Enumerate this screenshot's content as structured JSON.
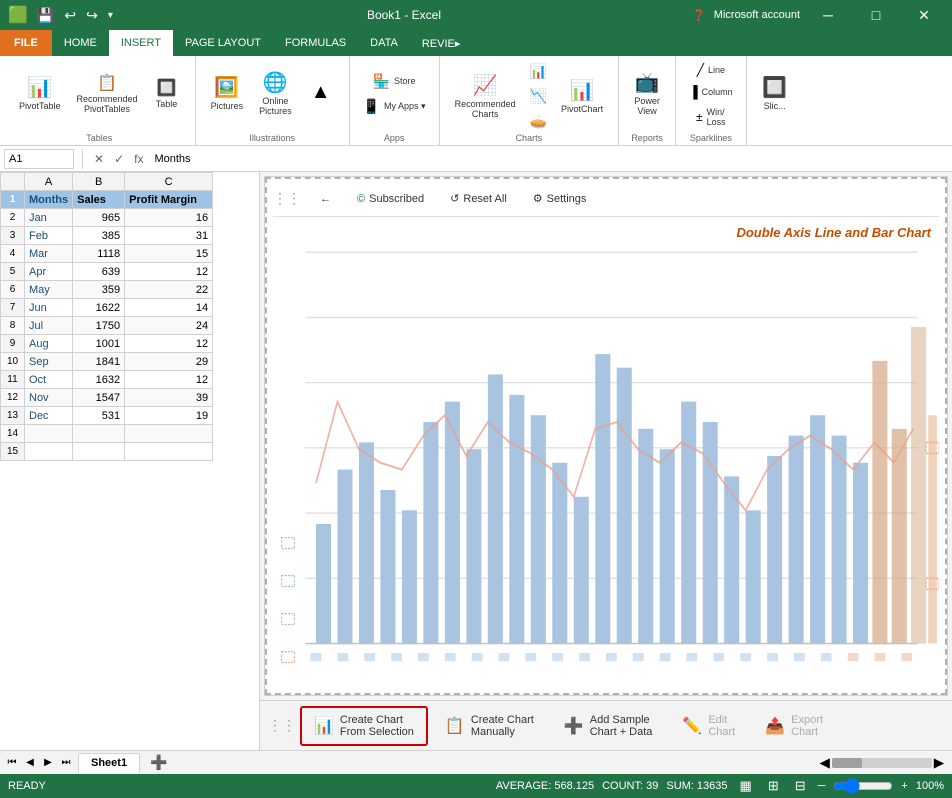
{
  "titleBar": {
    "title": "Book1 - Excel",
    "closeBtn": "✕",
    "minBtn": "─",
    "maxBtn": "□",
    "account": "Microsoft account"
  },
  "ribbon": {
    "tabs": [
      "FILE",
      "HOME",
      "INSERT",
      "PAGE LAYOUT",
      "FORMULAS",
      "DATA",
      "REVIE▸"
    ],
    "activeTab": "INSERT",
    "groups": {
      "tables": {
        "label": "Tables",
        "items": [
          "PivotTable",
          "Recommended PivotTables",
          "Table"
        ]
      },
      "illustrations": {
        "label": "Illustrations",
        "items": [
          "Pictures",
          "Online Pictures"
        ]
      },
      "apps": {
        "label": "Apps",
        "items": [
          "Store",
          "My Apps"
        ]
      },
      "charts": {
        "label": "Charts",
        "items": [
          "Recommended Charts",
          "PivotChart"
        ]
      },
      "reports": {
        "label": "Reports",
        "items": [
          "Power View"
        ]
      },
      "sparklines": {
        "label": "Sparklines",
        "items": [
          "Line",
          "Column",
          "Win/Loss"
        ]
      }
    }
  },
  "formulaBar": {
    "cellRef": "A1",
    "formula": "Months"
  },
  "spreadsheet": {
    "columns": [
      "",
      "A",
      "B",
      "C"
    ],
    "headers": [
      "Months",
      "Sales",
      "Profit Margin"
    ],
    "rows": [
      {
        "row": 2,
        "data": [
          "Jan",
          "965",
          "16"
        ]
      },
      {
        "row": 3,
        "data": [
          "Feb",
          "385",
          "31"
        ]
      },
      {
        "row": 4,
        "data": [
          "Mar",
          "1118",
          "15"
        ]
      },
      {
        "row": 5,
        "data": [
          "Apr",
          "639",
          "12"
        ]
      },
      {
        "row": 6,
        "data": [
          "May",
          "359",
          "22"
        ]
      },
      {
        "row": 7,
        "data": [
          "Jun",
          "1622",
          "14"
        ]
      },
      {
        "row": 8,
        "data": [
          "Jul",
          "1750",
          "24"
        ]
      },
      {
        "row": 9,
        "data": [
          "Aug",
          "1001",
          "12"
        ]
      },
      {
        "row": 10,
        "data": [
          "Sep",
          "1841",
          "29"
        ]
      },
      {
        "row": 11,
        "data": [
          "Oct",
          "1632",
          "12"
        ]
      },
      {
        "row": 12,
        "data": [
          "Nov",
          "1547",
          "39"
        ]
      },
      {
        "row": 13,
        "data": [
          "Dec",
          "531",
          "19"
        ]
      },
      {
        "row": 14,
        "data": [
          "",
          "",
          ""
        ]
      },
      {
        "row": 15,
        "data": [
          "",
          "",
          ""
        ]
      }
    ]
  },
  "chart": {
    "title": "Double Axis Line and Bar Chart",
    "toolbar": {
      "backBtn": "←",
      "subscribedLabel": "Subscribed",
      "resetAllLabel": "Reset All",
      "settingsLabel": "Settings"
    },
    "barData": [
      32,
      45,
      55,
      42,
      38,
      58,
      62,
      50,
      70,
      65,
      60,
      45,
      40,
      72,
      68,
      55,
      50,
      63,
      58,
      44,
      38,
      48,
      52,
      60,
      55,
      47
    ],
    "lineData": [
      28,
      55,
      42,
      35,
      30,
      48,
      52,
      38,
      45,
      40,
      35,
      30,
      28,
      42,
      48,
      38,
      32,
      40,
      35,
      28,
      25,
      32,
      38,
      45,
      42,
      35
    ],
    "barColor": "#a8c4e0",
    "lineColor": "#e8a090",
    "accentBarColor": "#e8b090"
  },
  "bottomBar": {
    "createFromSelectionLabel": "Create Chart\nFrom Selection",
    "createManuallyLabel": "Create Chart\nManually",
    "addSampleLabel": "Add Sample\nChart + Data",
    "editChartLabel": "Edit\nChart",
    "exportChartLabel": "Export\nChart"
  },
  "statusBar": {
    "status": "READY",
    "average": "AVERAGE: 568.125",
    "count": "COUNT: 39",
    "sum": "SUM: 13635",
    "zoom": "100%"
  },
  "sheetTabs": {
    "sheets": [
      "Sheet1"
    ],
    "active": "Sheet1"
  }
}
